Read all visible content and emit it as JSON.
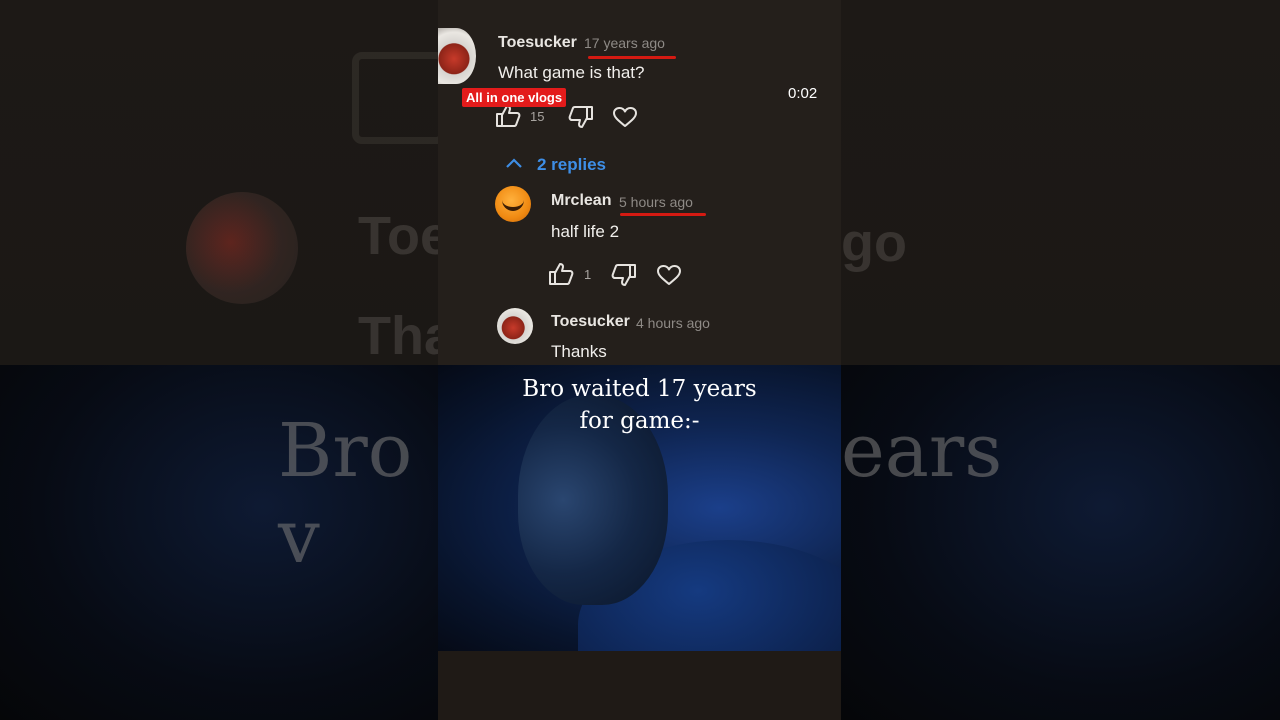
{
  "overlay": {
    "channel_badge": "All in one vlogs",
    "timestamp": "0:02",
    "caption_line1": "Bro waited 17 years",
    "caption_line2": "for game:-"
  },
  "comment": {
    "author": "Toesucker",
    "time": "17 years ago",
    "text": "What game is that?",
    "likes": "15",
    "replies_label": "2 replies"
  },
  "replies": [
    {
      "author": "Mrclean",
      "time": "5 hours ago",
      "text": "half life 2",
      "likes": "1"
    },
    {
      "author": "Toesucker",
      "time": "4 hours ago",
      "text": "Thanks"
    }
  ],
  "background": {
    "ghost_author": "Toe",
    "ghost_time": "go",
    "ghost_thanks": "Tha",
    "ghost_caption_left": "Bro v",
    "ghost_caption_right": "ears"
  },
  "colors": {
    "accent_red": "#d41a12",
    "link_blue": "#3e8ee6",
    "panel_bg": "#241f1b"
  }
}
